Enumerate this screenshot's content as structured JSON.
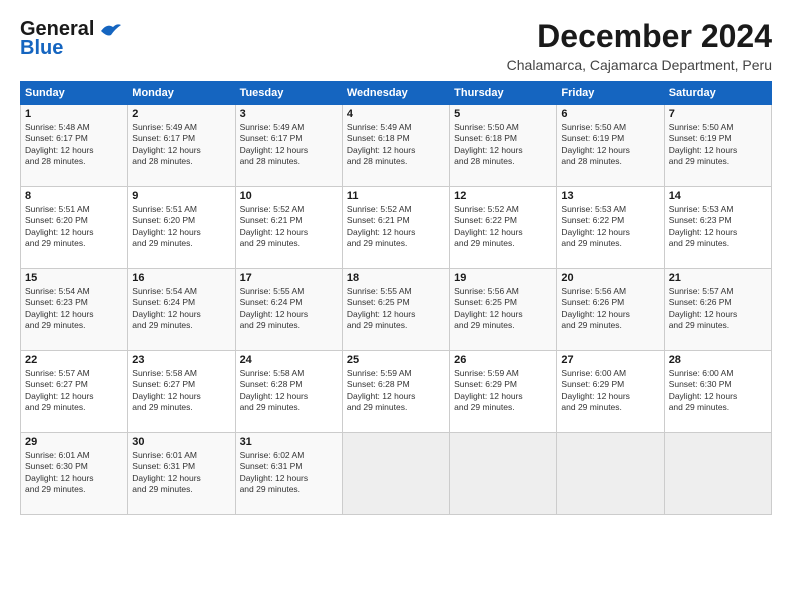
{
  "logo": {
    "line1": "General",
    "line2": "Blue"
  },
  "title": "December 2024",
  "subtitle": "Chalamarca, Cajamarca Department, Peru",
  "headers": [
    "Sunday",
    "Monday",
    "Tuesday",
    "Wednesday",
    "Thursday",
    "Friday",
    "Saturday"
  ],
  "weeks": [
    [
      {
        "day": "1",
        "detail": "Sunrise: 5:48 AM\nSunset: 6:17 PM\nDaylight: 12 hours\nand 28 minutes."
      },
      {
        "day": "2",
        "detail": "Sunrise: 5:49 AM\nSunset: 6:17 PM\nDaylight: 12 hours\nand 28 minutes."
      },
      {
        "day": "3",
        "detail": "Sunrise: 5:49 AM\nSunset: 6:17 PM\nDaylight: 12 hours\nand 28 minutes."
      },
      {
        "day": "4",
        "detail": "Sunrise: 5:49 AM\nSunset: 6:18 PM\nDaylight: 12 hours\nand 28 minutes."
      },
      {
        "day": "5",
        "detail": "Sunrise: 5:50 AM\nSunset: 6:18 PM\nDaylight: 12 hours\nand 28 minutes."
      },
      {
        "day": "6",
        "detail": "Sunrise: 5:50 AM\nSunset: 6:19 PM\nDaylight: 12 hours\nand 28 minutes."
      },
      {
        "day": "7",
        "detail": "Sunrise: 5:50 AM\nSunset: 6:19 PM\nDaylight: 12 hours\nand 29 minutes."
      }
    ],
    [
      {
        "day": "8",
        "detail": "Sunrise: 5:51 AM\nSunset: 6:20 PM\nDaylight: 12 hours\nand 29 minutes."
      },
      {
        "day": "9",
        "detail": "Sunrise: 5:51 AM\nSunset: 6:20 PM\nDaylight: 12 hours\nand 29 minutes."
      },
      {
        "day": "10",
        "detail": "Sunrise: 5:52 AM\nSunset: 6:21 PM\nDaylight: 12 hours\nand 29 minutes."
      },
      {
        "day": "11",
        "detail": "Sunrise: 5:52 AM\nSunset: 6:21 PM\nDaylight: 12 hours\nand 29 minutes."
      },
      {
        "day": "12",
        "detail": "Sunrise: 5:52 AM\nSunset: 6:22 PM\nDaylight: 12 hours\nand 29 minutes."
      },
      {
        "day": "13",
        "detail": "Sunrise: 5:53 AM\nSunset: 6:22 PM\nDaylight: 12 hours\nand 29 minutes."
      },
      {
        "day": "14",
        "detail": "Sunrise: 5:53 AM\nSunset: 6:23 PM\nDaylight: 12 hours\nand 29 minutes."
      }
    ],
    [
      {
        "day": "15",
        "detail": "Sunrise: 5:54 AM\nSunset: 6:23 PM\nDaylight: 12 hours\nand 29 minutes."
      },
      {
        "day": "16",
        "detail": "Sunrise: 5:54 AM\nSunset: 6:24 PM\nDaylight: 12 hours\nand 29 minutes."
      },
      {
        "day": "17",
        "detail": "Sunrise: 5:55 AM\nSunset: 6:24 PM\nDaylight: 12 hours\nand 29 minutes."
      },
      {
        "day": "18",
        "detail": "Sunrise: 5:55 AM\nSunset: 6:25 PM\nDaylight: 12 hours\nand 29 minutes."
      },
      {
        "day": "19",
        "detail": "Sunrise: 5:56 AM\nSunset: 6:25 PM\nDaylight: 12 hours\nand 29 minutes."
      },
      {
        "day": "20",
        "detail": "Sunrise: 5:56 AM\nSunset: 6:26 PM\nDaylight: 12 hours\nand 29 minutes."
      },
      {
        "day": "21",
        "detail": "Sunrise: 5:57 AM\nSunset: 6:26 PM\nDaylight: 12 hours\nand 29 minutes."
      }
    ],
    [
      {
        "day": "22",
        "detail": "Sunrise: 5:57 AM\nSunset: 6:27 PM\nDaylight: 12 hours\nand 29 minutes."
      },
      {
        "day": "23",
        "detail": "Sunrise: 5:58 AM\nSunset: 6:27 PM\nDaylight: 12 hours\nand 29 minutes."
      },
      {
        "day": "24",
        "detail": "Sunrise: 5:58 AM\nSunset: 6:28 PM\nDaylight: 12 hours\nand 29 minutes."
      },
      {
        "day": "25",
        "detail": "Sunrise: 5:59 AM\nSunset: 6:28 PM\nDaylight: 12 hours\nand 29 minutes."
      },
      {
        "day": "26",
        "detail": "Sunrise: 5:59 AM\nSunset: 6:29 PM\nDaylight: 12 hours\nand 29 minutes."
      },
      {
        "day": "27",
        "detail": "Sunrise: 6:00 AM\nSunset: 6:29 PM\nDaylight: 12 hours\nand 29 minutes."
      },
      {
        "day": "28",
        "detail": "Sunrise: 6:00 AM\nSunset: 6:30 PM\nDaylight: 12 hours\nand 29 minutes."
      }
    ],
    [
      {
        "day": "29",
        "detail": "Sunrise: 6:01 AM\nSunset: 6:30 PM\nDaylight: 12 hours\nand 29 minutes."
      },
      {
        "day": "30",
        "detail": "Sunrise: 6:01 AM\nSunset: 6:31 PM\nDaylight: 12 hours\nand 29 minutes."
      },
      {
        "day": "31",
        "detail": "Sunrise: 6:02 AM\nSunset: 6:31 PM\nDaylight: 12 hours\nand 29 minutes."
      },
      {
        "day": "",
        "detail": ""
      },
      {
        "day": "",
        "detail": ""
      },
      {
        "day": "",
        "detail": ""
      },
      {
        "day": "",
        "detail": ""
      }
    ]
  ]
}
